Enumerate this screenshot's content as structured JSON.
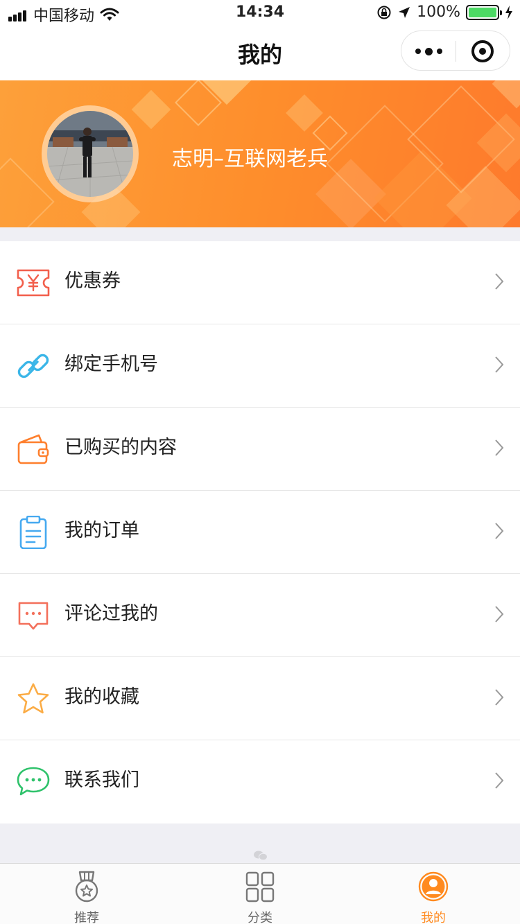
{
  "status_bar": {
    "carrier": "中国移动",
    "time": "14:34",
    "battery": "100%"
  },
  "nav": {
    "title": "我的"
  },
  "profile": {
    "username": "志明–互联网老兵"
  },
  "menu": [
    {
      "label": "优惠券",
      "icon": "coupon-icon",
      "color": "#f25f4c"
    },
    {
      "label": "绑定手机号",
      "icon": "link-icon",
      "color": "#3bb6e8"
    },
    {
      "label": "已购买的内容",
      "icon": "wallet-icon",
      "color": "#fe7f2d"
    },
    {
      "label": "我的订单",
      "icon": "clipboard-icon",
      "color": "#45a9f0"
    },
    {
      "label": "评论过我的",
      "icon": "comment-icon",
      "color": "#f3705b"
    },
    {
      "label": "我的收藏",
      "icon": "star-icon",
      "color": "#fbac45"
    },
    {
      "label": "联系我们",
      "icon": "chat-icon",
      "color": "#2fc26b"
    }
  ],
  "tabs": [
    {
      "label": "推荐",
      "icon": "medal-icon"
    },
    {
      "label": "分类",
      "icon": "grid-icon"
    },
    {
      "label": "我的",
      "icon": "user-icon",
      "active": true
    }
  ],
  "colors": {
    "accent": "#ff8a1f",
    "banner_start": "#fda03a",
    "banner_end": "#fe7a2c"
  }
}
